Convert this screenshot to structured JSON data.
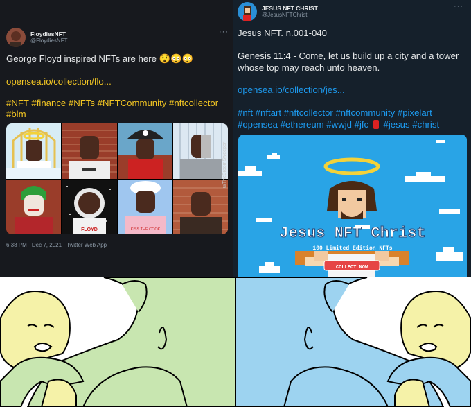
{
  "left_tweet": {
    "display_name": "FloydiesNFT",
    "handle": "@FloydiesNFT",
    "more_icon": "more-horizontal-icon",
    "text_line1": "George Floyd inspired NFTs are here 😲😳😳",
    "link": "opensea.io/collection/flo...",
    "hashtags_line1": "#NFT #finance #NFTs #NFTCommunity #nftcollector",
    "hashtags_line2": "#blm",
    "timestamp": "6:38 PM · Dec 7, 2021 · Twitter Web App",
    "tile_text": {
      "shirt_label": "FLOYD",
      "apron_label": "KISS THE COOK"
    },
    "colors": {
      "link": "#f3c623",
      "background": "#17191e"
    }
  },
  "right_tweet": {
    "display_name": "JESUS NFT CHRIST",
    "handle": "@JesusNFTChrist",
    "more_icon": "more-horizontal-icon",
    "title": "Jesus NFT. n.001-040",
    "body_line1": "Genesis 11:4 - Come, let us build up a city and a tower",
    "body_line2": "whose top may reach unto heaven.",
    "link": "opensea.io/collection/jes...",
    "hashtags_line1": "#nft #nftart #nftcollector #nftcommunity #pixelart",
    "hashtags_line2_a": "#opensea #ethereum #wwjd #jfc",
    "hashtags_line2_b": "#jesus #christ",
    "emoji_icon": "fire-extinguisher-icon",
    "art": {
      "title": "Jesus NFT Christ",
      "subtitle": "100 Limited Edition NFTs",
      "button": "COLLECT NOW"
    },
    "colors": {
      "link": "#1d9bf0",
      "background": "#15202b",
      "art_sky": "#29a4e6"
    }
  },
  "watermark": "u/TheBroomSweeper",
  "meme": {
    "left_bg": "#c8e6b0",
    "right_bg": "#9dd3f0"
  }
}
